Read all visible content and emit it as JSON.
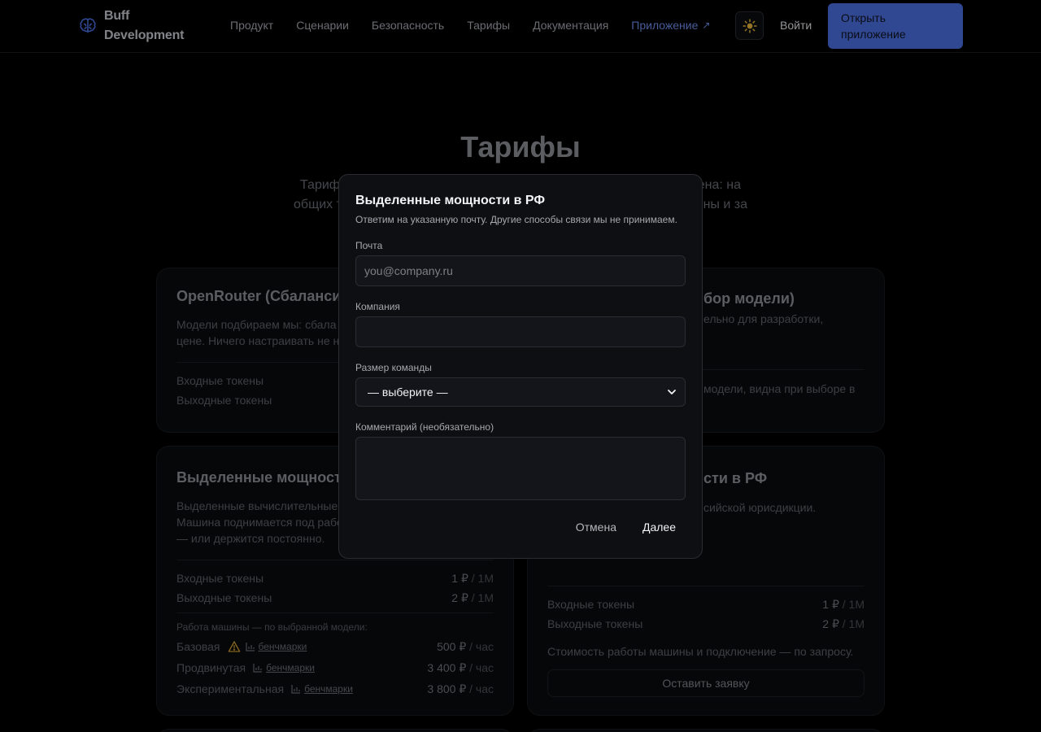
{
  "header": {
    "brand": "Buff Development",
    "nav": [
      "Продукт",
      "Сценарии",
      "Безопасность",
      "Тарифы",
      "Документация"
    ],
    "nav_app": "Приложение",
    "login": "Войти",
    "open_app": "Открыть приложение"
  },
  "page": {
    "title": "Тарифы",
    "subtitle_line1_left": "Тариф",
    "subtitle_line1_right": "ена: на",
    "subtitle_line2_left": "общих т",
    "subtitle_line2_right": "ны и за"
  },
  "cards": {
    "openrouter": {
      "title": "OpenRouter (Сбаланси",
      "desc_line1": "Модели подбираем мы: сбала",
      "desc_line2": "цене. Ничего настраивать не н",
      "rows": [
        "Входные токены",
        "Выходные токены"
      ]
    },
    "choice": {
      "title_fragment": "бор модели)",
      "desc_fragment": "ельно для разработки,",
      "row_fragment_line1": "модели, видна при выборе в",
      "row_fragment_line2": ""
    },
    "dedicated": {
      "title": "Выделенные мощност",
      "desc_line1": "Выделенные вычислительные",
      "desc_line2": "Машина поднимается под рабо",
      "desc_line3": "— или держится постоянно.",
      "input_label": "Входные токены",
      "input_price": "1 ₽",
      "output_label": "Выходные токены",
      "output_price": "2 ₽",
      "unit": "/ 1M",
      "machine_label": "Работа машины — по выбранной модели:",
      "tiers": [
        {
          "name": "Базовая",
          "bench": "бенчмарки",
          "price": "500 ₽",
          "unit": "/ час"
        },
        {
          "name": "Продвинутая",
          "bench": "бенчмарки",
          "price": "3 400 ₽",
          "unit": "/ час"
        },
        {
          "name": "Экспериментальная",
          "bench": "бенчмарки",
          "price": "3 800 ₽",
          "unit": "/ час"
        }
      ]
    },
    "dedicated_rf": {
      "title_fragment": "сти в РФ",
      "desc_fragment": "сийской юрисдикции.",
      "input_label": "Входные токены",
      "input_price": "1 ₽",
      "output_label": "Выходные токены",
      "output_price": "2 ₽",
      "unit": "/ 1M",
      "note": "Стоимость работы машины и подключение — по запросу.",
      "request_button": "Оставить заявку"
    }
  },
  "modal": {
    "title": "Выделенные мощности в РФ",
    "hint": "Ответим на указанную почту. Другие способы связи мы не принимаем.",
    "email_label": "Почта",
    "email_placeholder": "you@company.ru",
    "company_label": "Компания",
    "company_value": "",
    "team_label": "Размер команды",
    "team_selected": "— выберите —",
    "comment_label": "Комментарий (необязательно)",
    "cancel": "Отмена",
    "next": "Далее"
  },
  "colors": {
    "accent": "#4a6fe0",
    "link": "#6f8fe8",
    "background": "#000000",
    "modal_bg": "#0e0f12"
  }
}
